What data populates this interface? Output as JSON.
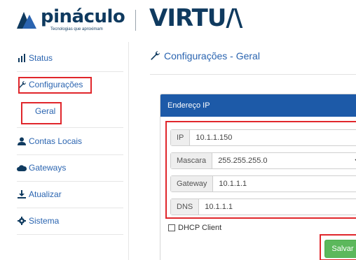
{
  "header": {
    "brand_name": "pinácu",
    "brand_name_o": "lo",
    "brand_tagline": "Tecnologias que aproximam",
    "product_name": "VIRTU",
    "product_name_tail": "/\\"
  },
  "sidebar": {
    "items": [
      {
        "label": "Status",
        "icon": "bar-chart-icon"
      },
      {
        "label": "Configurações",
        "icon": "wrench-icon"
      },
      {
        "label": "Geral",
        "icon": ""
      },
      {
        "label": "Contas Locais",
        "icon": "user-icon"
      },
      {
        "label": "Gateways",
        "icon": "cloud-icon"
      },
      {
        "label": "Atualizar",
        "icon": "download-icon"
      },
      {
        "label": "Sistema",
        "icon": "gear-icon"
      }
    ]
  },
  "main": {
    "title": "Configurações - Geral",
    "panel_title": "Endereço IP",
    "fields": [
      {
        "label": "IP",
        "value": "10.1.1.150"
      },
      {
        "label": "Mascara",
        "value": "255.255.255.0"
      },
      {
        "label": "Gateway",
        "value": "10.1.1.1"
      },
      {
        "label": "DNS",
        "value": "10.1.1.1"
      }
    ],
    "dhcp_label": "DHCP Client",
    "dhcp_checked": false,
    "save_label": "Salvar"
  },
  "colors": {
    "accent": "#1d5aa8",
    "link": "#2a64b0",
    "brand": "#0f3a5f",
    "highlight": "#e0262b",
    "save": "#5cb85c"
  }
}
